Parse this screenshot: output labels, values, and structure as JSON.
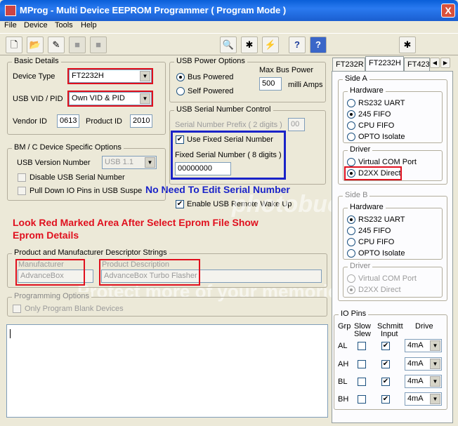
{
  "window": {
    "title": "MProg - Multi Device EEPROM Programmer ( Program Mode )",
    "close": "X"
  },
  "menu": [
    "File",
    "Device",
    "Tools",
    "Help"
  ],
  "toolbar": {
    "buttons": [
      {
        "icon": "new-file-icon",
        "glyph": "🗋"
      },
      {
        "icon": "open-folder-icon",
        "glyph": "📂"
      },
      {
        "icon": "edit-icon",
        "glyph": "✎"
      },
      {
        "icon": "stop-icon",
        "glyph": "■"
      },
      {
        "icon": "stop-icon",
        "glyph": "■"
      },
      {
        "icon": "search-icon",
        "glyph": "🔍"
      },
      {
        "icon": "program-icon",
        "glyph": "✱"
      },
      {
        "icon": "lightning-icon",
        "glyph": "⚡"
      },
      {
        "icon": "help-icon",
        "glyph": "?"
      },
      {
        "icon": "info-icon",
        "glyph": "?"
      },
      {
        "icon": "com-port-icon",
        "glyph": "✱"
      }
    ]
  },
  "basic": {
    "legend": "Basic Details",
    "device_type_label": "Device Type",
    "device_type_value": "FT2232H",
    "vidpid_label": "USB VID / PID",
    "vidpid_value": "Own VID & PID",
    "vendor_label": "Vendor ID",
    "vendor_value": "0613",
    "product_label": "Product ID",
    "product_value": "2010"
  },
  "power": {
    "legend": "USB Power Options",
    "bus": "Bus Powered",
    "self": "Self Powered",
    "max_label": "Max Bus Power",
    "max_value": "500",
    "unit": "milli Amps"
  },
  "serial": {
    "legend": "USB Serial Number Control",
    "prefix_label": "Serial Number Prefix ( 2 digits )",
    "prefix_value": "00",
    "use_fixed": "Use Fixed Serial Number",
    "fixed_label": "Fixed Serial Number ( 8 digits )",
    "fixed_value": "00000000"
  },
  "bmc": {
    "legend": "BM / C Device Specific Options",
    "usb_version_label": "USB Version Number",
    "usb_version_value": "USB 1.1",
    "disable_serial": "Disable USB Serial Number",
    "pull_down": "Pull Down IO Pins in USB Suspend"
  },
  "remote_wake": "Enable USB Remote Wake Up",
  "descriptors": {
    "legend": "Product and Manufacturer Descriptor Strings",
    "manufacturer_label": "Manufacturer",
    "manufacturer_value": "AdvanceBox",
    "product_label": "Product Description",
    "product_value": "AdvanceBox Turbo Flasher"
  },
  "programming": {
    "legend": "Programming Options",
    "blank_only": "Only Program Blank Devices"
  },
  "annotations": {
    "serial_note": "No Need To Edit Serial Number",
    "red_note_line1": "Look Red Marked Area After Select Eprom File Show",
    "red_note_line2": "Eprom Details"
  },
  "watermark": {
    "text1": "Protect more of your memories for less!",
    "text2": "photobucket"
  },
  "tabs": [
    "FT232R",
    "FT2232H",
    "FT423"
  ],
  "side_a": {
    "legend": "Side A",
    "hardware_legend": "Hardware",
    "hw": [
      "RS232 UART",
      "245 FIFO",
      "CPU FIFO",
      "OPTO Isolate"
    ],
    "driver_legend": "Driver",
    "drivers": [
      "Virtual COM Port",
      "D2XX Direct"
    ]
  },
  "side_b": {
    "legend": "Side B",
    "hardware_legend": "Hardware",
    "hw": [
      "RS232 UART",
      "245 FIFO",
      "CPU FIFO",
      "OPTO Isolate"
    ],
    "driver_legend": "Driver",
    "drivers": [
      "Virtual COM Port",
      "D2XX Direct"
    ]
  },
  "io": {
    "legend": "IO Pins",
    "h_grp": "Grp",
    "h_slow1": "Slow",
    "h_slow2": "Slew",
    "h_sch1": "Schmitt",
    "h_sch2": "Input",
    "h_drive": "Drive",
    "rows": [
      {
        "grp": "AL",
        "drive": "4mA"
      },
      {
        "grp": "AH",
        "drive": "4mA"
      },
      {
        "grp": "BL",
        "drive": "4mA"
      },
      {
        "grp": "BH",
        "drive": "4mA"
      }
    ]
  },
  "colors": {
    "annotation_red": "#e0101e",
    "annotation_blue": "#1a23c8",
    "titlebar": "#0a5fd8"
  }
}
